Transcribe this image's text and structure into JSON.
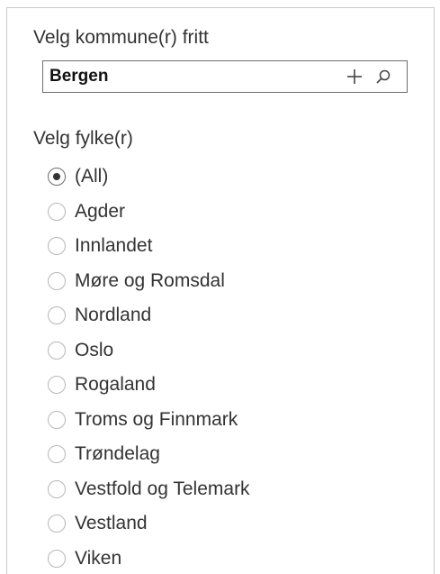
{
  "kommune_filter": {
    "label": "Velg kommune(r) fritt",
    "input_value": "Bergen",
    "add_icon": "plus-icon",
    "search_icon": "search-icon"
  },
  "fylke_filter": {
    "label": "Velg fylke(r)",
    "selected": "(All)",
    "options": [
      {
        "label": "(All)"
      },
      {
        "label": "Agder"
      },
      {
        "label": "Innlandet"
      },
      {
        "label": "Møre og Romsdal"
      },
      {
        "label": "Nordland"
      },
      {
        "label": "Oslo"
      },
      {
        "label": "Rogaland"
      },
      {
        "label": "Troms og Finnmark"
      },
      {
        "label": "Trøndelag"
      },
      {
        "label": "Vestfold og Telemark"
      },
      {
        "label": "Vestland"
      },
      {
        "label": "Viken"
      }
    ]
  }
}
